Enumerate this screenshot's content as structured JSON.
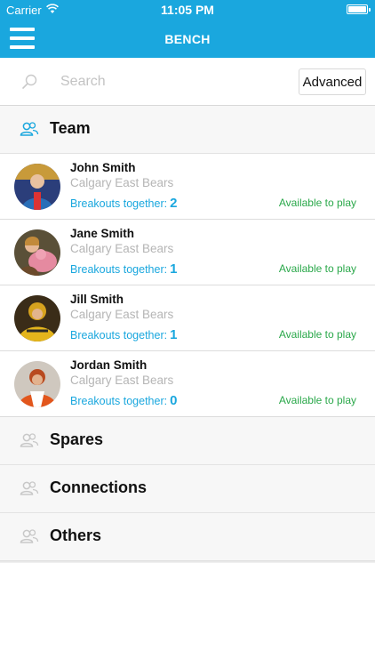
{
  "status_bar": {
    "carrier": "Carrier",
    "time": "11:05 PM"
  },
  "nav": {
    "title": "BENCH"
  },
  "search": {
    "placeholder": "Search",
    "advanced_label": "Advanced"
  },
  "sections": {
    "team": {
      "label": "Team",
      "icon": "people-icon",
      "color": "#1aa7de"
    },
    "spares": {
      "label": "Spares",
      "icon": "people-icon"
    },
    "connections": {
      "label": "Connections",
      "icon": "people-icon"
    },
    "others": {
      "label": "Others",
      "icon": "people-icon"
    }
  },
  "players": [
    {
      "name": "John Smith",
      "team": "Calgary East Bears",
      "breakouts_label": "Breakouts together:",
      "breakouts_count": "2",
      "availability": "Available to play"
    },
    {
      "name": "Jane Smith",
      "team": "Calgary East Bears",
      "breakouts_label": "Breakouts together:",
      "breakouts_count": "1",
      "availability": "Available to play"
    },
    {
      "name": "Jill Smith",
      "team": "Calgary East Bears",
      "breakouts_label": "Breakouts together:",
      "breakouts_count": "1",
      "availability": "Available to play"
    },
    {
      "name": "Jordan Smith",
      "team": "Calgary East Bears",
      "breakouts_label": "Breakouts together:",
      "breakouts_count": "0",
      "availability": "Available to play"
    }
  ],
  "colors": {
    "accent": "#1aa7de",
    "available": "#2aa84a",
    "muted": "#b5b5b5"
  }
}
